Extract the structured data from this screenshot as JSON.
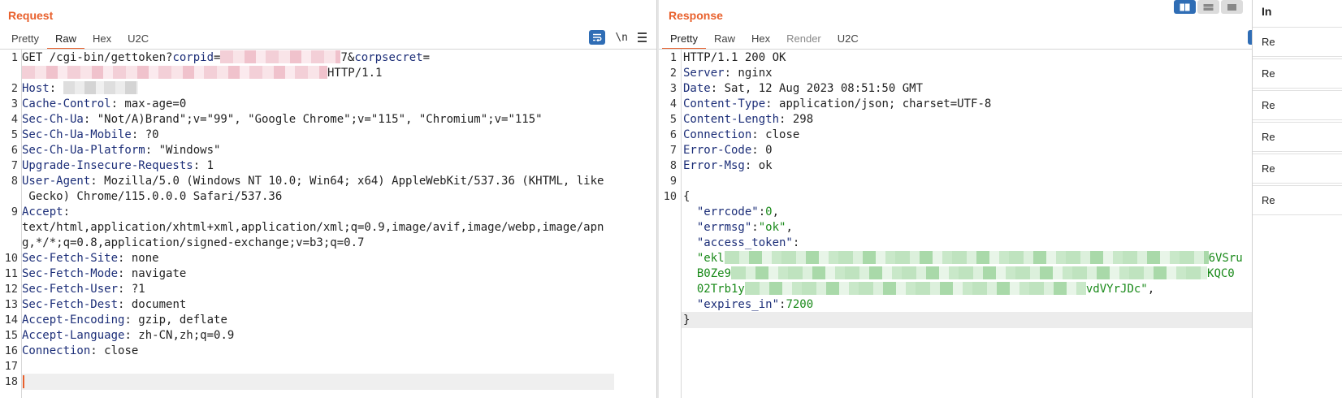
{
  "request": {
    "title": "Request",
    "tabs": [
      {
        "label": "Pretty",
        "state": "inactive"
      },
      {
        "label": "Raw",
        "state": "active"
      },
      {
        "label": "Hex",
        "state": "inactive"
      },
      {
        "label": "U2C",
        "state": "inactive"
      }
    ],
    "tools": {
      "wrap_icon": "wrap-text-icon",
      "newline_label": "\\n",
      "menu_icon": "hamburger-menu-icon"
    },
    "lines": [
      {
        "n": "1",
        "parts": [
          {
            "t": "GET /cgi-bin/gettoken?",
            "c": "hv"
          },
          {
            "t": "corpid",
            "c": "hk"
          },
          {
            "t": "=",
            "c": "hv"
          },
          {
            "redact": "pink",
            "w": 148
          },
          {
            "t": "7&",
            "c": "hv"
          },
          {
            "t": "corpsecret",
            "c": "hk"
          },
          {
            "t": "=",
            "c": "hv"
          }
        ]
      },
      {
        "n": "",
        "parts": [
          {
            "redact": "pink",
            "w": 376
          },
          {
            "t": "HTTP/1.1",
            "c": "hv"
          }
        ]
      },
      {
        "n": "2",
        "parts": [
          {
            "t": "Host",
            "c": "hk"
          },
          {
            "t": ": ",
            "c": "hv"
          },
          {
            "redact": "grey",
            "w": 92
          }
        ]
      },
      {
        "n": "3",
        "parts": [
          {
            "t": "Cache-Control",
            "c": "hk"
          },
          {
            "t": ": max-age=0",
            "c": "hv"
          }
        ]
      },
      {
        "n": "4",
        "parts": [
          {
            "t": "Sec-Ch-Ua",
            "c": "hk"
          },
          {
            "t": ": \"Not/A)Brand\";v=\"99\", \"Google Chrome\";v=\"115\", \"Chromium\";v=\"115\"",
            "c": "hv"
          }
        ]
      },
      {
        "n": "5",
        "parts": [
          {
            "t": "Sec-Ch-Ua-Mobile",
            "c": "hk"
          },
          {
            "t": ": ?0",
            "c": "hv"
          }
        ]
      },
      {
        "n": "6",
        "parts": [
          {
            "t": "Sec-Ch-Ua-Platform",
            "c": "hk"
          },
          {
            "t": ": \"Windows\"",
            "c": "hv"
          }
        ]
      },
      {
        "n": "7",
        "parts": [
          {
            "t": "Upgrade-Insecure-Requests",
            "c": "hk"
          },
          {
            "t": ": 1",
            "c": "hv"
          }
        ]
      },
      {
        "n": "8",
        "parts": [
          {
            "t": "User-Agent",
            "c": "hk"
          },
          {
            "t": ": Mozilla/5.0 (Windows NT 10.0; Win64; x64) AppleWebKit/537.36 (KHTML, like",
            "c": "hv"
          }
        ]
      },
      {
        "n": "",
        "parts": [
          {
            "t": " Gecko) Chrome/115.0.0.0 Safari/537.36",
            "c": "hv"
          }
        ]
      },
      {
        "n": "9",
        "parts": [
          {
            "t": "Accept",
            "c": "hk"
          },
          {
            "t": ":",
            "c": "hv"
          }
        ]
      },
      {
        "n": "",
        "parts": [
          {
            "t": "text/html,application/xhtml+xml,application/xml;q=0.9,image/avif,image/webp,image/apn",
            "c": "hv"
          }
        ]
      },
      {
        "n": "",
        "parts": [
          {
            "t": "g,*/*;q=0.8,application/signed-exchange;v=b3;q=0.7",
            "c": "hv"
          }
        ]
      },
      {
        "n": "10",
        "parts": [
          {
            "t": "Sec-Fetch-Site",
            "c": "hk"
          },
          {
            "t": ": none",
            "c": "hv"
          }
        ]
      },
      {
        "n": "11",
        "parts": [
          {
            "t": "Sec-Fetch-Mode",
            "c": "hk"
          },
          {
            "t": ": navigate",
            "c": "hv"
          }
        ]
      },
      {
        "n": "12",
        "parts": [
          {
            "t": "Sec-Fetch-User",
            "c": "hk"
          },
          {
            "t": ": ?1",
            "c": "hv"
          }
        ]
      },
      {
        "n": "13",
        "parts": [
          {
            "t": "Sec-Fetch-Dest",
            "c": "hk"
          },
          {
            "t": ": document",
            "c": "hv"
          }
        ]
      },
      {
        "n": "14",
        "parts": [
          {
            "t": "Accept-Encoding",
            "c": "hk"
          },
          {
            "t": ": gzip, deflate",
            "c": "hv"
          }
        ]
      },
      {
        "n": "15",
        "parts": [
          {
            "t": "Accept-Language",
            "c": "hk"
          },
          {
            "t": ": zh-CN,zh;q=0.9",
            "c": "hv"
          }
        ]
      },
      {
        "n": "16",
        "parts": [
          {
            "t": "Connection",
            "c": "hk"
          },
          {
            "t": ": close",
            "c": "hv"
          }
        ]
      },
      {
        "n": "17",
        "parts": []
      },
      {
        "n": "18",
        "parts": [],
        "cursor": true
      }
    ]
  },
  "response": {
    "title": "Response",
    "tabs": [
      {
        "label": "Pretty",
        "state": "active"
      },
      {
        "label": "Raw",
        "state": "inactive"
      },
      {
        "label": "Hex",
        "state": "inactive"
      },
      {
        "label": "Render",
        "state": "muted"
      },
      {
        "label": "U2C",
        "state": "inactive"
      }
    ],
    "tools": {
      "wrap_icon": "wrap-text-icon",
      "newline_label": "\\n",
      "menu_icon": "hamburger-menu-icon"
    },
    "lines": [
      {
        "n": "1",
        "parts": [
          {
            "t": "HTTP/1.1 200 OK",
            "c": "hv"
          }
        ]
      },
      {
        "n": "2",
        "parts": [
          {
            "t": "Server",
            "c": "hk"
          },
          {
            "t": ": nginx",
            "c": "hv"
          }
        ]
      },
      {
        "n": "3",
        "parts": [
          {
            "t": "Date",
            "c": "hk"
          },
          {
            "t": ": Sat, 12 Aug 2023 08:51:50 GMT",
            "c": "hv"
          }
        ]
      },
      {
        "n": "4",
        "parts": [
          {
            "t": "Content-Type",
            "c": "hk"
          },
          {
            "t": ": application/json; charset=UTF-8",
            "c": "hv"
          }
        ]
      },
      {
        "n": "5",
        "parts": [
          {
            "t": "Content-Length",
            "c": "hk"
          },
          {
            "t": ": 298",
            "c": "hv"
          }
        ]
      },
      {
        "n": "6",
        "parts": [
          {
            "t": "Connection",
            "c": "hk"
          },
          {
            "t": ": close",
            "c": "hv"
          }
        ]
      },
      {
        "n": "7",
        "parts": [
          {
            "t": "Error-Code",
            "c": "hk"
          },
          {
            "t": ": 0",
            "c": "hv"
          }
        ]
      },
      {
        "n": "8",
        "parts": [
          {
            "t": "Error-Msg",
            "c": "hk"
          },
          {
            "t": ": ok",
            "c": "hv"
          }
        ]
      },
      {
        "n": "9",
        "parts": []
      },
      {
        "n": "10",
        "parts": [
          {
            "t": "{",
            "c": "jp"
          }
        ]
      },
      {
        "n": "",
        "parts": [
          {
            "t": "  ",
            "c": "jp"
          },
          {
            "t": "\"errcode\"",
            "c": "jk"
          },
          {
            "t": ":",
            "c": "jp"
          },
          {
            "t": "0",
            "c": "jn"
          },
          {
            "t": ",",
            "c": "jp"
          }
        ]
      },
      {
        "n": "",
        "parts": [
          {
            "t": "  ",
            "c": "jp"
          },
          {
            "t": "\"errmsg\"",
            "c": "jk"
          },
          {
            "t": ":",
            "c": "jp"
          },
          {
            "t": "\"ok\"",
            "c": "js"
          },
          {
            "t": ",",
            "c": "jp"
          }
        ]
      },
      {
        "n": "",
        "parts": [
          {
            "t": "  ",
            "c": "jp"
          },
          {
            "t": "\"access_token\"",
            "c": "jk"
          },
          {
            "t": ":",
            "c": "jp"
          }
        ]
      },
      {
        "n": "",
        "parts": [
          {
            "t": "  ",
            "c": "jp"
          },
          {
            "t": "\"ekl",
            "c": "js"
          },
          {
            "redact": "green",
            "w": 596
          },
          {
            "t": "6VSru",
            "c": "js"
          }
        ]
      },
      {
        "n": "",
        "parts": [
          {
            "t": "  ",
            "c": "jp"
          },
          {
            "t": "B0Ze9",
            "c": "js"
          },
          {
            "redact": "green",
            "w": 586
          },
          {
            "t": "KQC0",
            "c": "js"
          }
        ]
      },
      {
        "n": "",
        "parts": [
          {
            "t": "  ",
            "c": "jp"
          },
          {
            "t": "02Trb1y",
            "c": "js"
          },
          {
            "redact": "green",
            "w": 420
          },
          {
            "t": "vdVYrJDc\"",
            "c": "js"
          },
          {
            "t": ",",
            "c": "jp"
          }
        ]
      },
      {
        "n": "",
        "parts": [
          {
            "t": "  ",
            "c": "jp"
          },
          {
            "t": "\"expires_in\"",
            "c": "jk"
          },
          {
            "t": ":",
            "c": "jp"
          },
          {
            "t": "7200",
            "c": "jn"
          }
        ]
      },
      {
        "n": "",
        "parts": [
          {
            "t": "}",
            "c": "jp"
          }
        ],
        "highlight": true
      }
    ]
  },
  "view_toggle": [
    {
      "icon": "split-columns-icon",
      "state": "active"
    },
    {
      "icon": "split-rows-icon",
      "state": "inactive"
    },
    {
      "icon": "single-pane-icon",
      "state": "inactive"
    }
  ],
  "inspector": {
    "title": "In",
    "rows": [
      "Re",
      "Re",
      "Re",
      "Re",
      "Re",
      "Re"
    ]
  }
}
